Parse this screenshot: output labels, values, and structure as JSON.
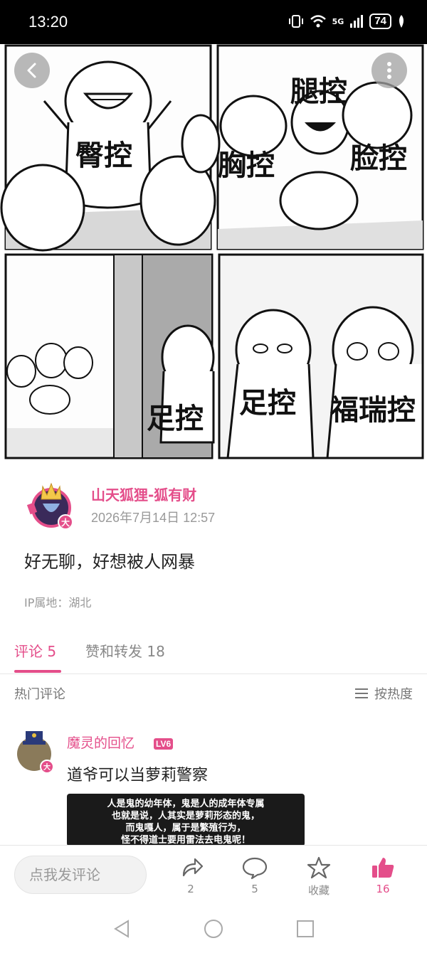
{
  "status_bar": {
    "time": "13:20",
    "network": "5G",
    "battery": "74"
  },
  "comic": {
    "panels": [
      "臀控",
      "腿控",
      "胸控",
      "脸控",
      "足控",
      "足控",
      "福瑞控"
    ]
  },
  "post": {
    "author_name": "山天狐狸-狐有财",
    "timestamp": "2026年7月14日 12:57",
    "text": "好无聊，好想被人网暴",
    "ip_location": "IP属地：湖北",
    "avatar_badge": "大"
  },
  "tabs": [
    {
      "label": "评论 5"
    },
    {
      "label": "赞和转发 18"
    }
  ],
  "hot_comments": {
    "title": "热门评论",
    "sort_label": "按热度"
  },
  "comment": {
    "user": "魔灵的回忆",
    "level": "LV6",
    "text": "道爷可以当萝莉警察",
    "avatar_badge": "大",
    "image_lines": [
      "人是鬼的幼年体，鬼是人的成年体专属",
      "也就是说，人其实是萝莉形态的鬼，",
      "而鬼嘎人，属于是繁殖行为，",
      "怪不得道士要用雷法去电鬼呢！"
    ]
  },
  "bottom_bar": {
    "comment_placeholder": "点我发评论",
    "share_count": "2",
    "comment_count": "5",
    "favorite_label": "收藏",
    "like_count": "16"
  },
  "colors": {
    "accent": "#e44e8a",
    "muted": "#999999"
  },
  "icons": [
    "back-icon",
    "more-icon",
    "share-icon",
    "comment-icon",
    "star-icon",
    "like-icon",
    "nav-back-icon",
    "nav-home-icon",
    "nav-recents-icon"
  ]
}
